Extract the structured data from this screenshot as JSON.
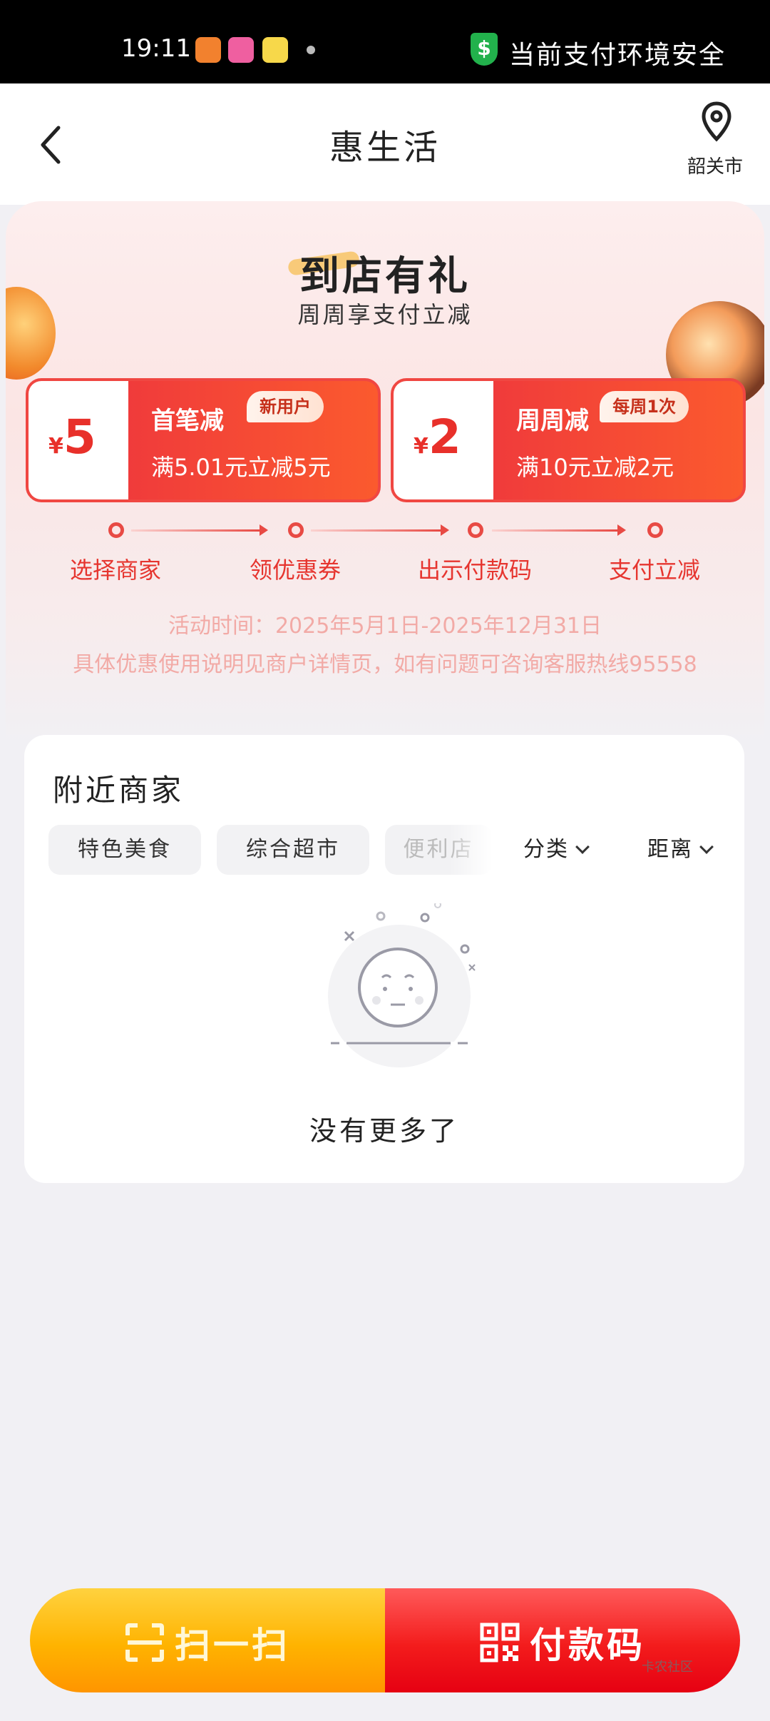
{
  "status_bar": {
    "time": "19:11",
    "security_text": "当前支付环境安全",
    "security_icon": "shield-dollar-icon"
  },
  "header": {
    "title": "惠生活",
    "location": "韶关市"
  },
  "banner": {
    "title": "到店有礼",
    "subtitle": "周周享支付立减",
    "coupons": [
      {
        "currency": "¥",
        "amount": "5",
        "title": "首笔减",
        "tag": "新用户",
        "desc": "满5.01元立减5元"
      },
      {
        "currency": "¥",
        "amount": "2",
        "title": "周周减",
        "tag": "每周1次",
        "desc": "满10元立减2元"
      }
    ],
    "steps": [
      "选择商家",
      "领优惠券",
      "出示付款码",
      "支付立减"
    ],
    "activity_time": "活动时间：2025年5月1日-2025年12月31日",
    "notice": "具体优惠使用说明见商户详情页，如有问题可咨询客服热线95558"
  },
  "nearby": {
    "title": "附近商家",
    "chips": [
      "特色美食",
      "综合超市",
      "便利店"
    ],
    "filters": [
      "分类",
      "距离"
    ],
    "empty_text": "没有更多了"
  },
  "bottom_bar": {
    "scan_label": "扫一扫",
    "pay_label": "付款码"
  },
  "watermark": "卡农社区",
  "colors": {
    "accent_red": "#f04742",
    "scan_yellow": "#ffb300",
    "pay_red": "#f31c1c",
    "security_green": "#22b14c"
  }
}
